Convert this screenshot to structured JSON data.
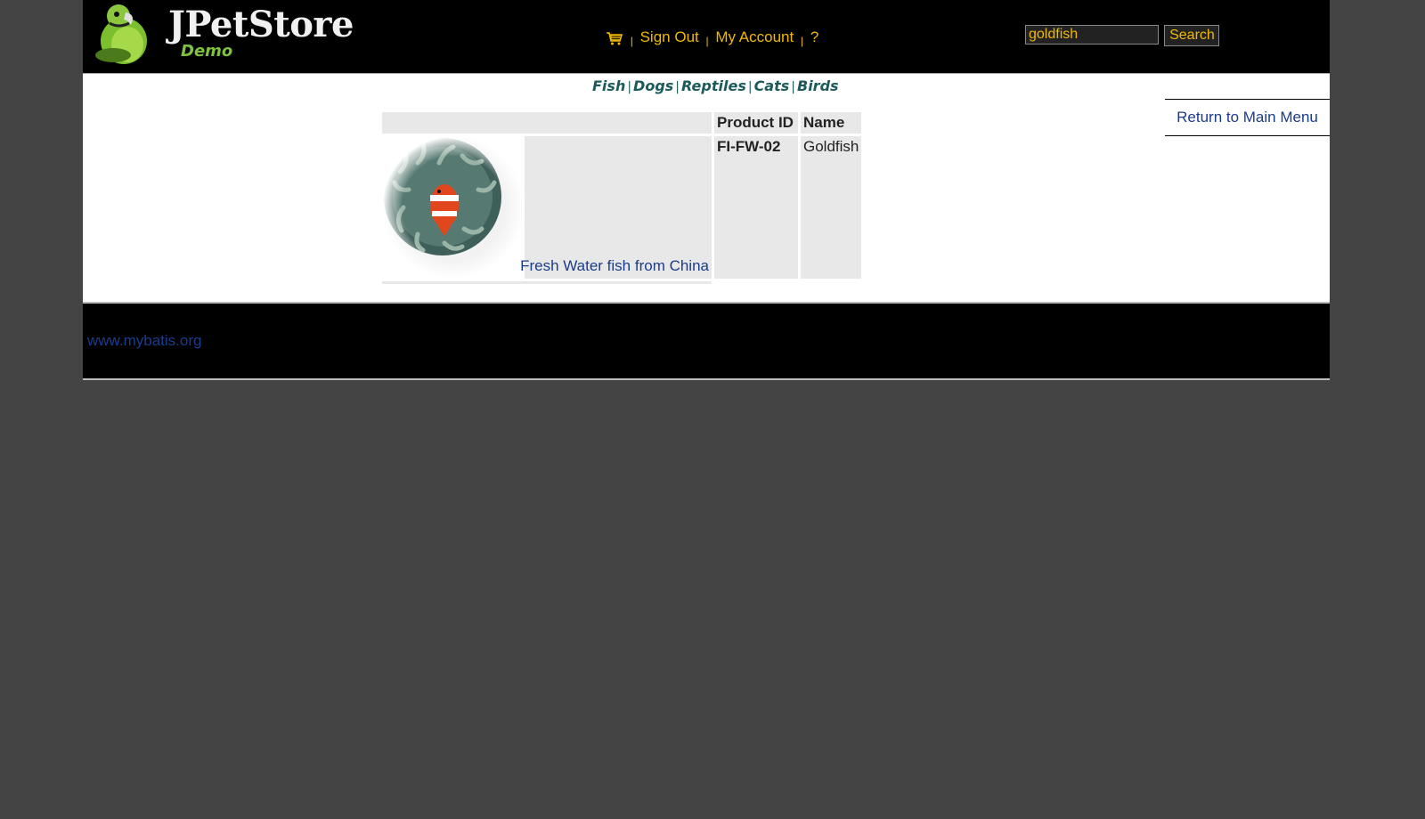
{
  "header": {
    "logo_title": "JPetStore",
    "logo_subtitle": "Demo",
    "menu": {
      "cart_icon": "shopping-cart-icon",
      "sign_out": "Sign Out",
      "my_account": "My Account",
      "help": "?",
      "separator": "|"
    },
    "search": {
      "value": "goldfish",
      "button_label": "Search"
    }
  },
  "quick_links": [
    "Fish",
    "Dogs",
    "Reptiles",
    "Cats",
    "Birds"
  ],
  "back_link": "Return to Main Menu",
  "catalog": {
    "headers": [
      "",
      "Product ID",
      "Name"
    ],
    "rows": [
      {
        "image_icon": "clownfish-image",
        "description": "Fresh Water fish from China",
        "product_id": "FI-FW-02",
        "name": "Goldfish"
      }
    ]
  },
  "footer": {
    "link": "www.mybatis.org"
  },
  "colors": {
    "background": "#444444",
    "header_bg": "#000000",
    "menu_link": "#f0b800",
    "content_link": "#1a3c8c",
    "table_cell": "#e8e8e8",
    "quicklink": "#1d5b5b"
  }
}
